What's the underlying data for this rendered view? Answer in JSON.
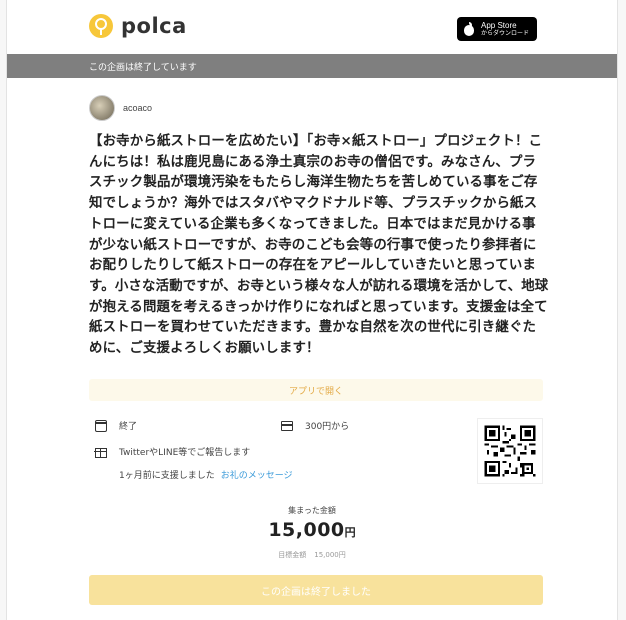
{
  "header": {
    "logo_text": "polca",
    "appstore": {
      "title": "App Store",
      "subtitle": "からダウンロード"
    }
  },
  "status_bar": {
    "text": "この企画は終了しています"
  },
  "author": {
    "name": "acoaco"
  },
  "description": "【お寺から紙ストローを広めたい】「お寺×紙ストロー」プロジェクト！こんにちは！私は鹿児島にある浄土真宗のお寺の僧侶です。みなさん、プラスチック製品が環境汚染をもたらし海洋生物たちを苦しめている事をご存知でしょうか？海外ではスタバやマクドナルド等、プラスチックから紙ストローに変えている企業も多くなってきました。日本ではまだ見かける事が少ない紙ストローですが、お寺のこども会等の行事で使ったり参拝者にお配りしたりして紙ストローの存在をアピールしていきたいと思っています。小さな活動ですが、お寺という様々な人が訪れる環境を活かして、地球が抱える問題を考えるきっかけ作りになればと思っています。支援金は全て紙ストローを買わせていただきます。豊かな自然を次の世代に引き継ぐために、ご支援よろしくお願いします！",
  "app_button": {
    "label": "アプリで開く"
  },
  "info": {
    "status": "終了",
    "price": "300円から",
    "reward": "TwitterやLINE等でご報告します"
  },
  "support": {
    "time_text": "1ヶ月前に支援しました",
    "message_link": "お礼のメッセージ"
  },
  "totals": {
    "label": "集まった金額",
    "amount": "15,000",
    "unit": "円",
    "target_label": "目標金額",
    "target_value": "15,000円"
  },
  "ended_button": {
    "label": "この企画は終了しました"
  },
  "icons": {
    "logo": "polca-logo-icon",
    "apple": "apple-icon",
    "status": "calendar-icon",
    "price": "card-icon",
    "reward": "gift-icon",
    "qr": "qr-code"
  },
  "colors": {
    "accent_yellow": "#f7c73a",
    "status_bar": "#7f7f7f",
    "link_blue": "#3a9ad9",
    "app_button_text": "#e3a944",
    "ended_button_bg": "#f8e29c"
  }
}
